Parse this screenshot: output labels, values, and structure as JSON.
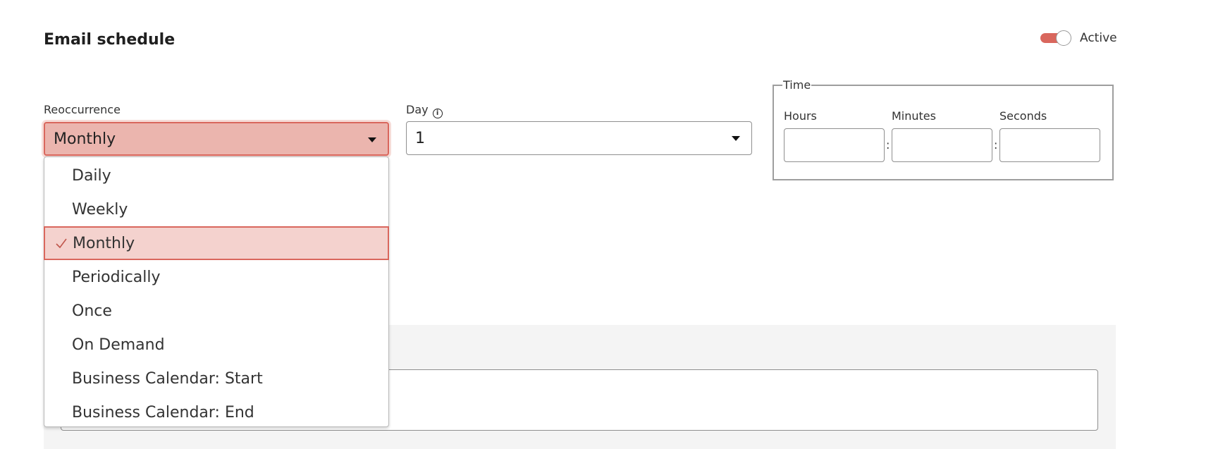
{
  "header": {
    "title": "Email schedule",
    "toggle_label": "Active",
    "toggle_on": true
  },
  "recurrence": {
    "label": "Reoccurrence",
    "value": "Monthly",
    "options": [
      "Daily",
      "Weekly",
      "Monthly",
      "Periodically",
      "Once",
      "On Demand",
      "Business Calendar: Start",
      "Business Calendar: End"
    ],
    "selected_index": 2
  },
  "day": {
    "label": "Day",
    "value": "1"
  },
  "time": {
    "legend": "Time",
    "hours_label": "Hours",
    "minutes_label": "Minutes",
    "seconds_label": "Seconds",
    "separator": ":",
    "hours_value": "",
    "minutes_value": "",
    "seconds_value": ""
  },
  "icons": {
    "info": "info-icon",
    "caret": "chevron-down-icon",
    "check": "check-icon"
  },
  "colors": {
    "accent": "#d9675d",
    "selected_bg": "#f4d2ce",
    "select_bg": "#ebb5ae",
    "panel_bg": "#f4f4f4"
  }
}
